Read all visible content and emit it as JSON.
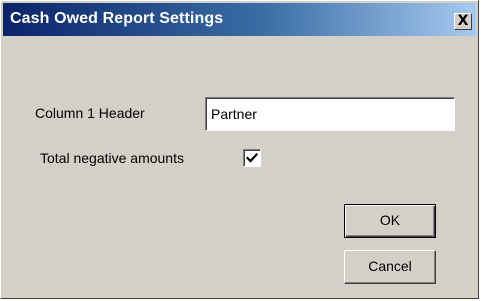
{
  "window": {
    "title": "Cash Owed Report Settings",
    "close_glyph": "X"
  },
  "form": {
    "column1_header_label": "Column 1 Header",
    "column1_header_value": "Partner",
    "total_negative_label": "Total negative amounts",
    "total_negative_checked": true
  },
  "buttons": {
    "ok_label": "OK",
    "cancel_label": "Cancel"
  },
  "icons": {
    "close": "close-icon",
    "check": "checkmark-icon"
  },
  "colors": {
    "titlebar_start": "#0a246a",
    "titlebar_end": "#a6caf0",
    "dialog_face": "#d4d0c8"
  }
}
